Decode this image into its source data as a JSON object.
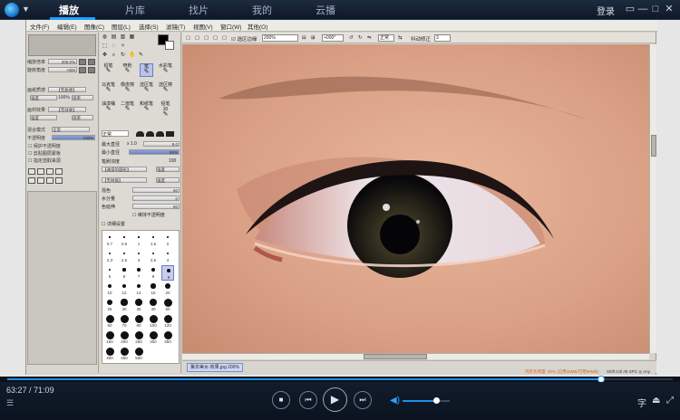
{
  "app": {
    "nav": [
      {
        "label": "播放",
        "active": true
      },
      {
        "label": "片库",
        "active": false
      },
      {
        "label": "找片",
        "active": false
      },
      {
        "label": "我的",
        "active": false
      },
      {
        "label": "云播",
        "active": false
      }
    ],
    "login_label": "登录",
    "window_icons": [
      "skin-icon",
      "minimize-icon",
      "maximize-icon",
      "close-icon"
    ],
    "accent_color": "#1ea0ff"
  },
  "sai": {
    "menu": [
      "文件(F)",
      "编辑(E)",
      "图像(C)",
      "图层(L)",
      "选择(S)",
      "滤镜(T)",
      "视图(V)",
      "窗口(W)",
      "其他(O)"
    ],
    "left_panel": {
      "zoom_label": "缩放倍率",
      "zoom_value": "200.0%",
      "rotate_label": "旋转角度",
      "rotate_value": "+000",
      "paper_texture_label": "画纸质感",
      "paper_texture_value": "【无质感】",
      "paper_texture_opts": [
        "强度",
        "100%",
        "倍率"
      ],
      "paper_effect_label": "画材效果",
      "paper_effect_value": "【无效果】",
      "paper_effect_opts": [
        "强度",
        "倍率"
      ],
      "blend_label": "混合模式",
      "blend_value": "正常",
      "opacity_label": "不透明度",
      "opacity_value": "100%",
      "checks": [
        "保护不透明度",
        "剪贴图层蒙板",
        "指定选取来源"
      ]
    },
    "tool_panel": {
      "brushes": [
        [
          "铅笔",
          "喷枪",
          "笔",
          "水彩笔"
        ],
        [
          "马克笔",
          "橡皮擦",
          "选区笔",
          "选区擦"
        ],
        [
          "油漆桶",
          "二值笔",
          "和纸笔",
          "铅笔30"
        ]
      ],
      "blend_value": "正常",
      "max_diameter_label": "最大直径",
      "max_diameter_mult": "x 1.0",
      "max_diameter_value": "9.0",
      "min_diameter_label": "最小直径",
      "min_diameter_value": "50%",
      "density_label": "笔刷浓度",
      "density_value": "100",
      "shape_value": "【通常的圆形】",
      "shape_opt": "强度",
      "texture_value": "【无材质】",
      "texture_opt": "强度",
      "mix_label": "混色",
      "mix_value": "50",
      "water_label": "水分量",
      "water_value": "0",
      "color_extend_label": "色延伸",
      "color_extend_value": "80",
      "keep_opacity_label": "维持不透明度",
      "detail_label": "详细设置",
      "sizes": [
        "0.7",
        "0.8",
        "1",
        "1.5",
        "2",
        "2.3",
        "2.6",
        "3",
        "3.5",
        "4",
        "5",
        "6",
        "7",
        "8",
        "9",
        "10",
        "12",
        "14",
        "16",
        "20",
        "25",
        "30",
        "35",
        "40",
        "50",
        "60",
        "70",
        "80",
        "100",
        "120",
        "160",
        "200",
        "250",
        "300",
        "350",
        "400",
        "450",
        "500"
      ],
      "selected_size": "9"
    },
    "toolbar": {
      "antialias_label": "选区边缘",
      "zoom_value": "200%",
      "angle_value": "+000°",
      "mode_value": "正常",
      "stabilizer_label": "抖动修正",
      "stabilizer_value": "3"
    },
    "status": {
      "file_tab": "薰衣美女-效果.jpg",
      "file_zoom": "200%",
      "memory_text": "内存负荷量: 60% (已用16MB/可用96MB)",
      "keys_text": "Shift Ctrl Alt SPC ◎ Any"
    }
  },
  "player": {
    "time_current": "63:27",
    "time_total": "71:09",
    "time_sep": " / ",
    "progress_fraction": 0.892,
    "volume_fraction": 0.72,
    "subtitle_label": "字"
  }
}
